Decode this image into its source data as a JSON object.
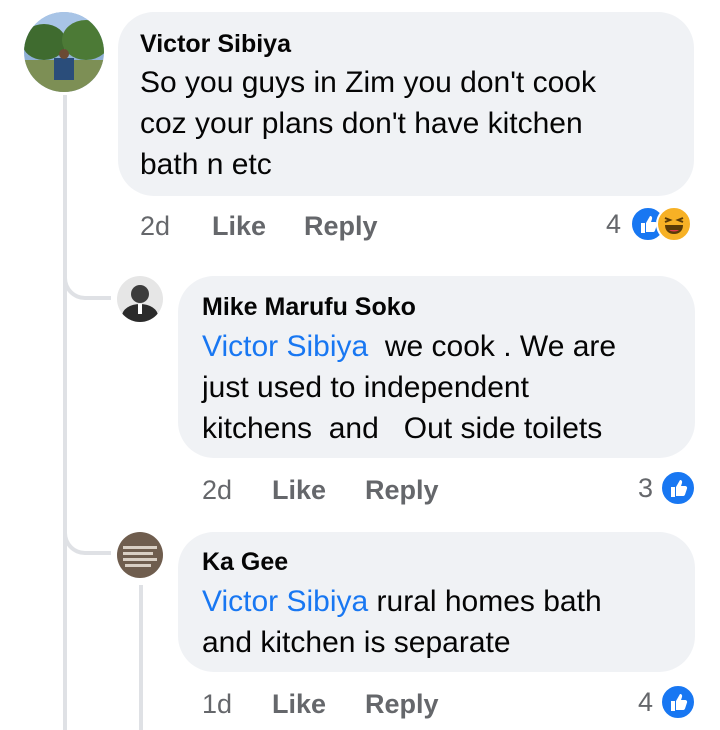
{
  "comments": [
    {
      "author": "Victor Sibiya",
      "lines": [
        "So you guys in Zim you don't cook",
        "coz your plans don't have kitchen",
        "bath n etc"
      ],
      "time": "2d",
      "like": "Like",
      "reply": "Reply",
      "reaction_count": "4",
      "reactions": [
        "like-icon",
        "haha-icon"
      ]
    },
    {
      "author": "Mike Marufu Soko",
      "mention": "Victor Sibiya",
      "line1_rest": "  we cook . We are",
      "line2": "just used to independent",
      "line3": "kitchens  and   Out side toilets",
      "time": "2d",
      "like": "Like",
      "reply": "Reply",
      "reaction_count": "3",
      "reactions": [
        "like-icon"
      ]
    },
    {
      "author": "Ka Gee",
      "mention": "Victor Sibiya",
      "line1_rest": " rural homes bath",
      "line2": "and kitchen is separate",
      "time": "1d",
      "like": "Like",
      "reply": "Reply",
      "reaction_count": "4",
      "reactions": [
        "like-icon"
      ]
    }
  ],
  "colors": {
    "bubble": "#f0f2f5",
    "mention": "#1877f2",
    "like": "#1877f2",
    "haha": "#f7b125",
    "meta": "#65676b"
  }
}
